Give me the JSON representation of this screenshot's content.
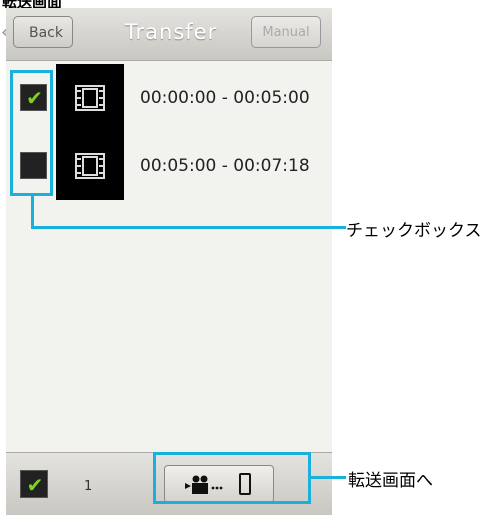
{
  "header_cut_text": "転送画面",
  "navbar": {
    "back_label": "Back",
    "title": "Transfer",
    "manual_label": "Manual"
  },
  "items": [
    {
      "time_range": "00:00:00 - 00:05:00",
      "checked": true
    },
    {
      "time_range": "00:05:00 - 00:07:18",
      "checked": false
    }
  ],
  "bottom": {
    "selected_count": "1"
  },
  "callouts": {
    "checkbox_label": "チェックボックス",
    "transfer_label": "転送画面へ"
  },
  "colors": {
    "highlight": "#1ab0dc",
    "check": "#7ed321"
  },
  "icons": {
    "film": "film-icon",
    "camera": "video-camera-icon",
    "phone": "smartphone-icon",
    "check": "checkmark-icon"
  }
}
